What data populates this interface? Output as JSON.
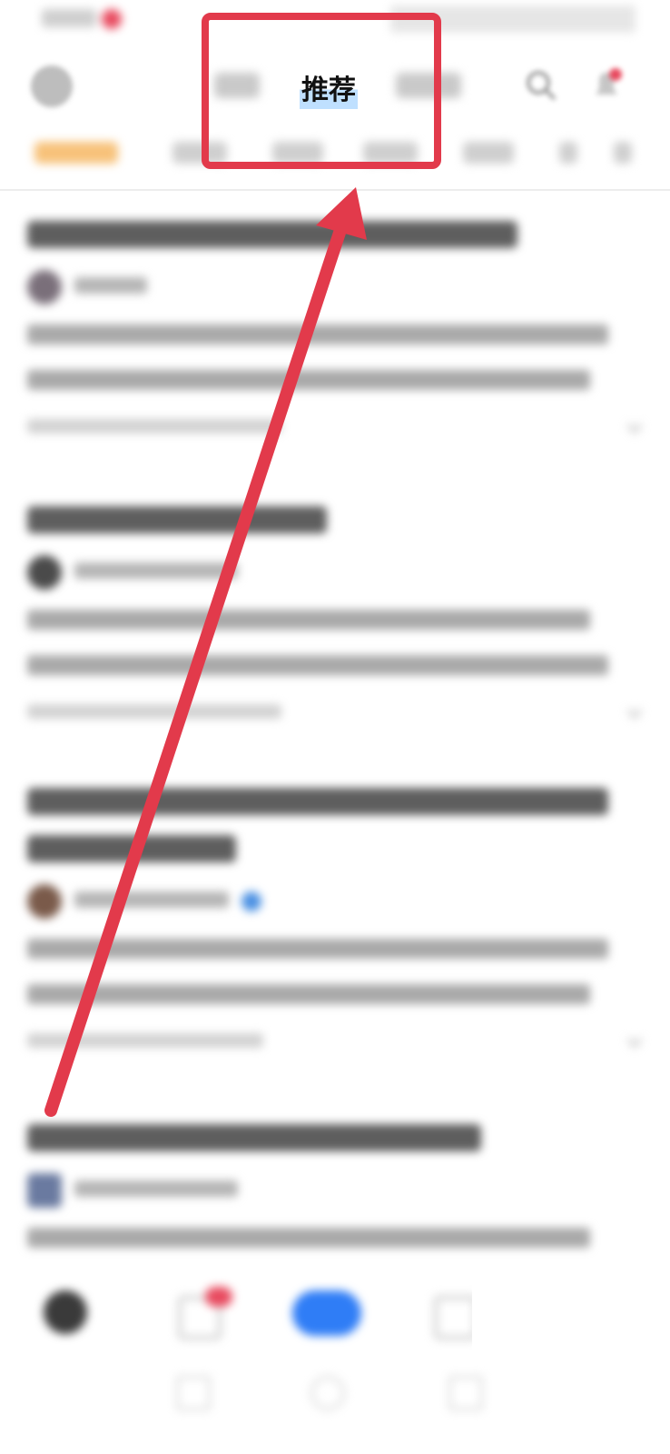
{
  "header": {
    "current_tab": "推荐"
  },
  "feed": {
    "items": [
      {
        "title": "",
        "author": "",
        "excerpt_line1": "",
        "excerpt_line2": "",
        "meta": ""
      },
      {
        "title": "",
        "author": "",
        "excerpt_line1": "",
        "excerpt_line2": "",
        "meta": ""
      },
      {
        "title": "",
        "author": "",
        "excerpt_line1": "",
        "excerpt_line2": "",
        "meta": ""
      },
      {
        "title": "",
        "author": "",
        "excerpt_line1": "",
        "meta": ""
      }
    ]
  },
  "colors": {
    "annotation_red": "#e23a4b",
    "accent_blue": "#2f7df6",
    "badge_red": "#e84a5f"
  },
  "icons": [
    "search-icon",
    "bell-icon",
    "avatar",
    "more-icon",
    "plus-icon",
    "back-icon",
    "home-icon"
  ]
}
